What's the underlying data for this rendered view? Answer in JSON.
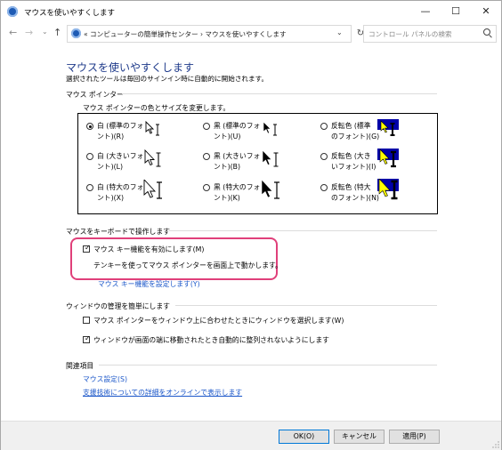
{
  "window": {
    "title": "マウスを使いやすくします",
    "minimize_glyph": "—",
    "maximize_glyph": "☐",
    "close_glyph": "✕"
  },
  "nav": {
    "back_glyph": "←",
    "forward_glyph": "→",
    "recent_glyph": "⌄",
    "up_glyph": "↑",
    "breadcrumb": "« コンピューターの簡単操作センター  ›  マウスを使いやすくします",
    "dropdown_glyph": "⌄",
    "refresh_glyph": "↻",
    "search_placeholder": "コントロール パネルの検索"
  },
  "main": {
    "heading": "マウスを使いやすくします",
    "subtext": "選択されたツールは毎回のサインイン時に自動的に開始されます。"
  },
  "pointers": {
    "group": "マウス ポインター",
    "label": "マウス ポインターの色とサイズを変更します。",
    "options": [
      {
        "line1": "白 (標準のフォ",
        "line2": "ント)(R)",
        "checked": true
      },
      {
        "line1": "黒 (標準のフォ",
        "line2": "ント)(U)",
        "checked": false
      },
      {
        "line1": "反転色 (標準",
        "line2": "のフォント)(G)",
        "checked": false
      },
      {
        "line1": "白 (大きいフォ",
        "line2": "ント)(L)",
        "checked": false
      },
      {
        "line1": "黒 (大きいフォ",
        "line2": "ント)(B)",
        "checked": false
      },
      {
        "line1": "反転色 (大き",
        "line2": "いフォント)(I)",
        "checked": false
      },
      {
        "line1": "白 (特大のフォ",
        "line2": "ント)(X)",
        "checked": false
      },
      {
        "line1": "黒 (特大のフォ",
        "line2": "ント)(K)",
        "checked": false
      },
      {
        "line1": "反転色 (特大",
        "line2": "のフォント)(N)",
        "checked": false
      }
    ]
  },
  "keyboard": {
    "group": "マウスをキーボードで操作します",
    "mousekeys_label": "マウス キー機能を有効にします(M)",
    "mousekeys_checked": true,
    "mousekeys_desc": "テンキーを使ってマウス ポインターを画面上で動かします。",
    "setup_link": "マウス キー機能を設定します(Y)"
  },
  "windows": {
    "group": "ウィンドウの管理を簡単にします",
    "hover_label": "マウス ポインターをウィンドウ上に合わせたときにウィンドウを選択します(W)",
    "hover_checked": false,
    "snap_label": "ウィンドウが画面の端に移動されたとき自動的に整列されないようにします",
    "snap_checked": true
  },
  "related": {
    "group": "関連項目",
    "link1": "マウス設定(S)",
    "link2": "支援技術についての詳細をオンラインで表示します"
  },
  "footer": {
    "ok": "OK(O)",
    "cancel": "キャンセル",
    "apply": "適用(P)"
  },
  "colors": {
    "link": "#1a56c9",
    "heading": "#1e3a8a",
    "highlight": "#e0407a",
    "inverted_bg": "#0000a8",
    "inverted_fg": "#ffff00"
  }
}
